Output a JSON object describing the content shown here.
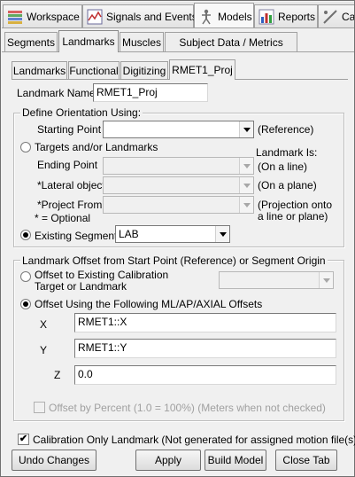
{
  "top_tabs": [
    {
      "label": "Workspace",
      "icon": "workspace-icon"
    },
    {
      "label": "Signals and Events",
      "icon": "signals-icon"
    },
    {
      "label": "Models",
      "icon": "models-icon"
    },
    {
      "label": "Reports",
      "icon": "reports-icon"
    },
    {
      "label": "Cal",
      "icon": "calibration-icon"
    }
  ],
  "sub_tabs": [
    "Segments",
    "Landmarks",
    "Muscles",
    "Subject Data / Metrics"
  ],
  "landmark_tabs": [
    "Landmarks",
    "Functional",
    "Digitizing",
    "RMET1_Proj"
  ],
  "landmark_name": {
    "label": "Landmark Name:",
    "value": "RMET1_Proj"
  },
  "orientation": {
    "title": "Define Orientation Using:",
    "starting_point_label": "Starting Point",
    "starting_point_value": "",
    "reference_note": "(Reference)",
    "targets_label": "Targets and/or Landmarks",
    "landmark_is": "Landmark Is:",
    "ending_point_label": "Ending Point",
    "ending_note": "(On a line)",
    "lateral_label": "*Lateral object",
    "lateral_note": "(On a plane)",
    "project_label": "*Project From",
    "project_note_1": "(Projection onto",
    "project_note_2": "a line or plane)",
    "optional_note": "* = Optional",
    "existing_label": "Existing Segment",
    "existing_value": "LAB"
  },
  "offset": {
    "title": "Landmark Offset from Start Point (Reference) or Segment Origin",
    "calib_label_1": "Offset to Existing Calibration",
    "calib_label_2": "Target or Landmark",
    "following_label": "Offset Using the Following ML/AP/AXIAL Offsets",
    "x_label": "X",
    "x_value": "RMET1::X",
    "y_label": "Y",
    "y_value": "RMET1::Y",
    "z_label": "Z",
    "z_value": "0.0",
    "percent_label": "Offset by Percent (1.0 = 100%) (Meters when not checked)"
  },
  "calibration_only": {
    "label": "Calibration Only Landmark (Not generated for assigned motion file(s))",
    "checked": "✔"
  },
  "buttons": {
    "undo": "Undo Changes",
    "apply": "Apply",
    "build": "Build Model",
    "close": "Close Tab"
  }
}
